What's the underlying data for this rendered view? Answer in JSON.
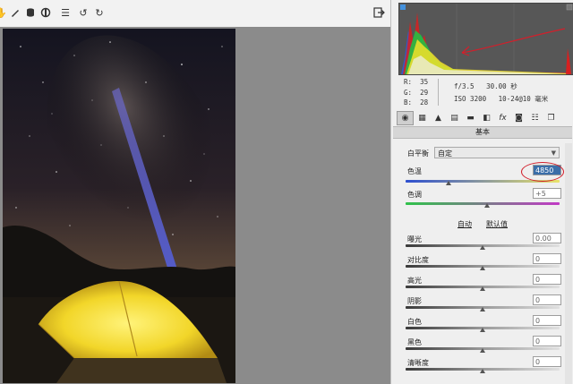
{
  "toolbar": {
    "left_icons": [
      "hand-icon",
      "brush-icon",
      "cylinder-icon",
      "circle-icon",
      "list-icon",
      "rotate-left-icon",
      "rotate-right-icon"
    ],
    "right_icon": "export-icon"
  },
  "info": {
    "r_label": "R:",
    "r_value": "35",
    "g_label": "G:",
    "g_value": "29",
    "b_label": "B:",
    "b_value": "28",
    "aperture": "f/3.5",
    "shutter": "30.00 秒",
    "iso": "ISO 3200",
    "focal": "10-24@10 毫米"
  },
  "panel_tabs": [
    "basic-icon",
    "tone-curve-icon",
    "detail-icon",
    "hsl-icon",
    "split-tone-icon",
    "lens-icon",
    "fx-icon",
    "camera-icon",
    "presets-icon",
    "snapshots-icon"
  ],
  "section_title": "基本",
  "white_balance": {
    "label": "白平衡",
    "value": "自定"
  },
  "temperature": {
    "label": "色温",
    "value": "4850",
    "fraction": 0.28
  },
  "tint": {
    "label": "色调",
    "value": "+5",
    "fraction": 0.53
  },
  "auto_label": "自动",
  "default_label": "默认值",
  "sliders": [
    {
      "label": "曝光",
      "value": "0.00",
      "fraction": 0.5
    },
    {
      "label": "对比度",
      "value": "0",
      "fraction": 0.5
    },
    {
      "label": "高光",
      "value": "0",
      "fraction": 0.5
    },
    {
      "label": "阴影",
      "value": "0",
      "fraction": 0.5
    },
    {
      "label": "白色",
      "value": "0",
      "fraction": 0.5
    },
    {
      "label": "黑色",
      "value": "0",
      "fraction": 0.5
    },
    {
      "label": "清晰度",
      "value": "0",
      "fraction": 0.5
    }
  ],
  "colors": {
    "annotation": "#d21f2b",
    "selection": "#3b6ea8"
  }
}
